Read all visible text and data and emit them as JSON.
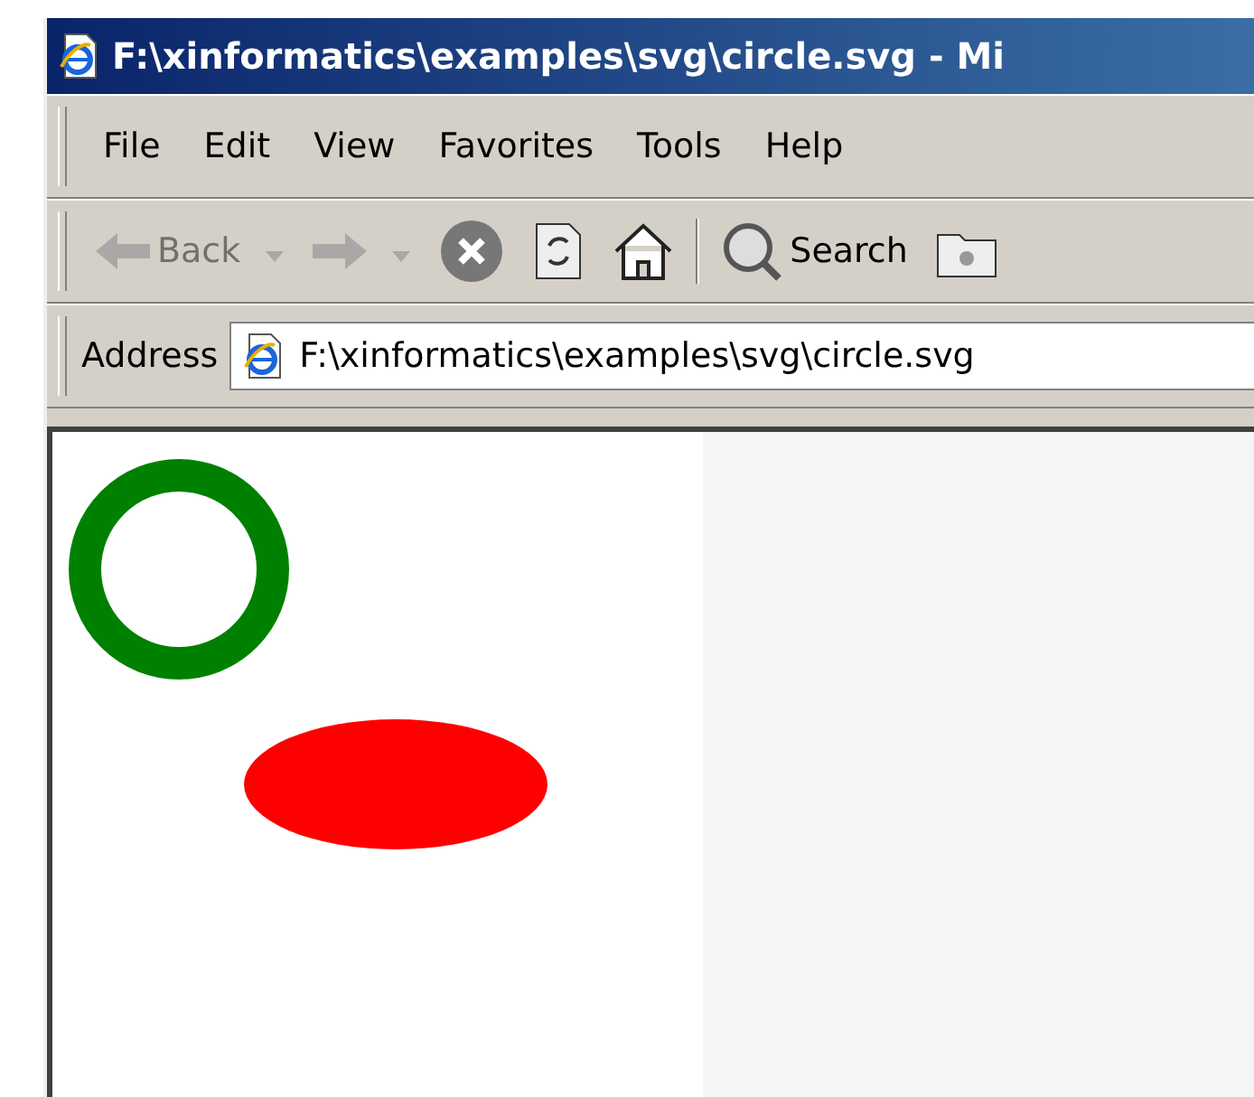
{
  "window": {
    "title": "F:\\xinformatics\\examples\\svg\\circle.svg - Mi"
  },
  "menu": [
    "File",
    "Edit",
    "View",
    "Favorites",
    "Tools",
    "Help"
  ],
  "toolbar": [
    {
      "kind": "back",
      "label": "Back",
      "disabled": true
    },
    {
      "kind": "forward",
      "disabled": true
    },
    {
      "kind": "stop",
      "disabled": false
    },
    {
      "kind": "refresh",
      "disabled": false
    },
    {
      "kind": "home",
      "disabled": false
    },
    {
      "kind": "search",
      "label": "Search",
      "disabled": false
    },
    {
      "kind": "folder",
      "disabled": false
    }
  ],
  "address": {
    "label": "Address",
    "value": "F:\\xinformatics\\examples\\svg\\circle.svg"
  }
}
